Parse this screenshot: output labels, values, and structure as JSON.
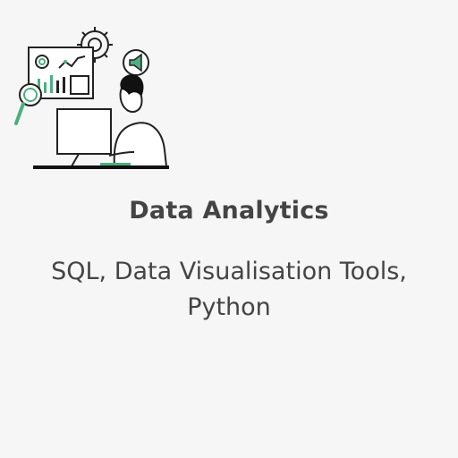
{
  "card": {
    "title": "Data Analytics",
    "subtitle": "SQL, Data Visualisation Tools, Python"
  },
  "illustration": {
    "icons": [
      "dashboard-icon",
      "gear-icon",
      "megaphone-icon",
      "magnifier-icon",
      "monitor-icon",
      "person-icon"
    ],
    "accent_color": "#4caf7d",
    "line_color": "#222222"
  }
}
